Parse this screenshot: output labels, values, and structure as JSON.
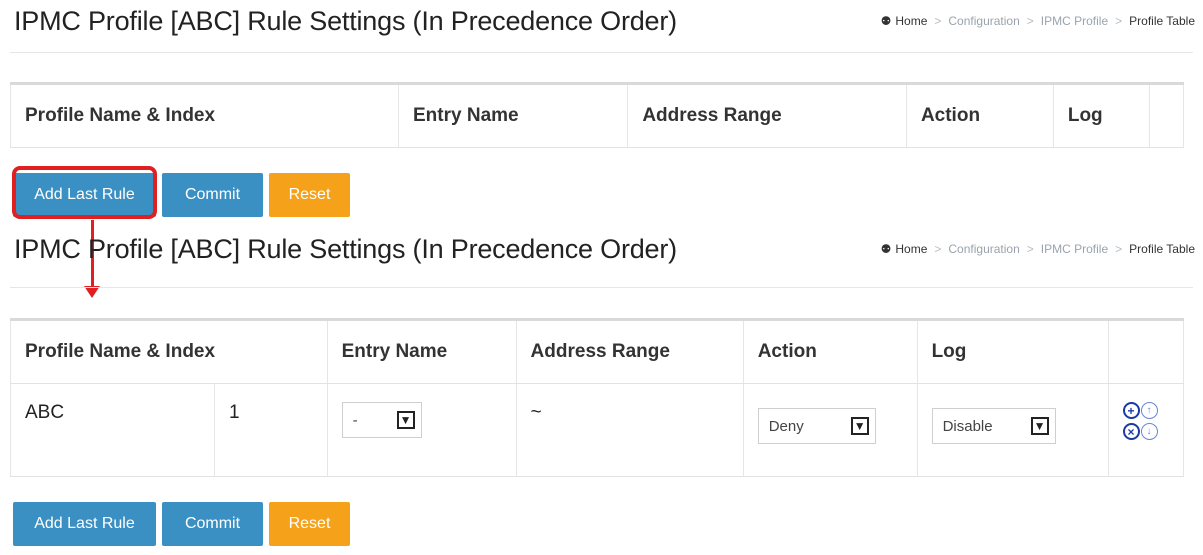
{
  "title": "IPMC Profile [ABC] Rule Settings (In Precedence Order)",
  "breadcrumb": {
    "home": "Home",
    "items": [
      "Configuration",
      "IPMC Profile"
    ],
    "current": "Profile Table",
    "separator": ">"
  },
  "table": {
    "headers": {
      "profile": "Profile Name & Index",
      "entry": "Entry Name",
      "address": "Address Range",
      "action": "Action",
      "log": "Log"
    }
  },
  "rule": {
    "profile_name": "ABC",
    "index": "1",
    "entry_value": "-",
    "address_range": "~",
    "action_value": "Deny",
    "log_value": "Disable"
  },
  "buttons": {
    "add_last_rule": "Add Last Rule",
    "commit": "Commit",
    "reset": "Reset"
  },
  "icons": {
    "insert": "+",
    "move_up": "↑",
    "delete": "×",
    "move_down": "↓"
  },
  "colors": {
    "primary_button": "#3a8fc3",
    "reset_button": "#f5a11a",
    "highlight": "#e02020"
  }
}
